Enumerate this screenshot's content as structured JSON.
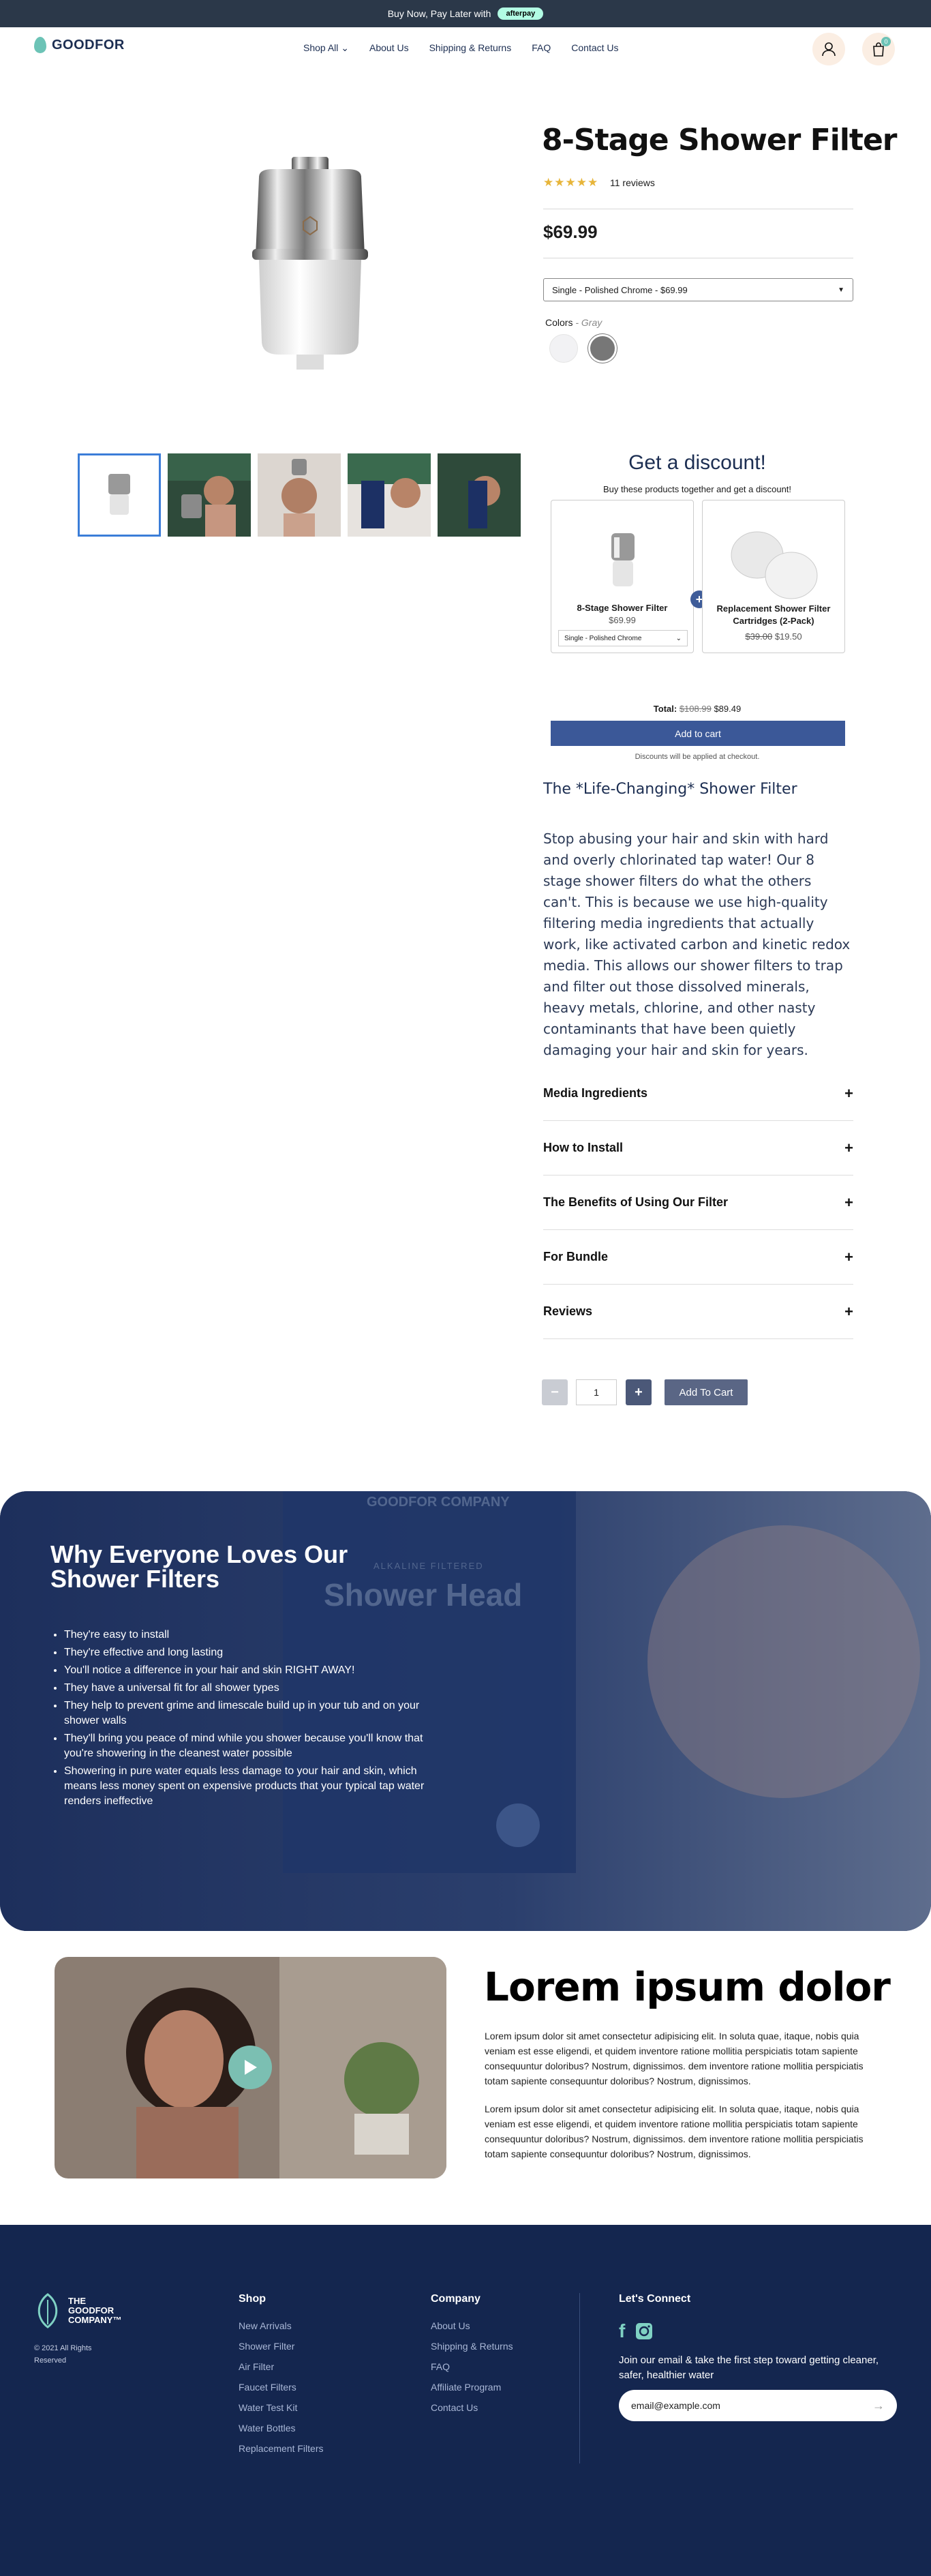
{
  "topbar": {
    "text": "Buy Now, Pay Later with",
    "badge": "afterpay"
  },
  "header": {
    "logo": "GOODFOR",
    "nav": [
      "Shop All",
      "About Us",
      "Shipping & Returns",
      "FAQ",
      "Contact Us"
    ],
    "cart_count": "0"
  },
  "product": {
    "title": "8-Stage Shower Filter",
    "stars": "★★★★★",
    "reviews": "11 reviews",
    "price": "$69.99",
    "variant": "Single - Polished Chrome - $69.99",
    "colors_label": "Colors",
    "colors_value": "- Gray",
    "swatches": [
      "#f2f2f4",
      "#7a7a7a"
    ]
  },
  "discount": {
    "title": "Get a discount!",
    "subtitle": "Buy these products together and get a discount!",
    "item1": {
      "name": "8-Stage Shower Filter",
      "price": "$69.99",
      "option": "Single - Polished Chrome"
    },
    "item2": {
      "name": "Replacement Shower Filter Cartridges (2-Pack)",
      "old_price": "$39.00",
      "price": "$19.50"
    },
    "total_label": "Total:",
    "total_old": "$108.99",
    "total_new": "$89.49",
    "button": "Add to cart",
    "note": "Discounts will be applied at checkout."
  },
  "description": {
    "heading": "The *Life-Changing* Shower Filter",
    "body": "Stop abusing your hair and skin with hard and overly chlorinated tap water! Our 8 stage shower filters do what the others can't. This is because we use high-quality filtering media ingredients that actually work, like activated carbon and kinetic redox media. This allows our shower filters to trap and filter out those dissolved minerals, heavy metals, chlorine, and other nasty contaminants that have been quietly damaging your hair and skin for years."
  },
  "accordion": [
    "Media Ingredients",
    "How to Install",
    "The Benefits of Using Our Filter",
    "For Bundle",
    "Reviews"
  ],
  "quantity": {
    "minus": "−",
    "value": "1",
    "plus": "+",
    "button": "Add To Cart"
  },
  "why": {
    "title": "Why Everyone Loves Our Shower Filters",
    "bg_text": "Shower Head",
    "bg_brand": "GOODFOR COMPANY",
    "bg_sub": "ALKALINE FILTERED",
    "items": [
      "They're easy to install",
      "They're effective and long lasting",
      "You'll notice a difference in your hair and skin RIGHT AWAY!",
      "They have a universal fit for all shower types",
      "They help to prevent grime and limescale build up in your tub and on your shower walls",
      "They'll bring you peace of mind while you shower because you'll know that you're showering in the cleanest water possible",
      "Showering in pure water equals less damage to your hair and skin, which means less money spent on expensive products that your typical tap water renders ineffective"
    ]
  },
  "lorem": {
    "heading": "Lorem ipsum dolor",
    "p1": "Lorem ipsum dolor sit amet consectetur adipisicing elit. In soluta quae, itaque, nobis quia veniam est esse eligendi, et quidem inventore ratione mollitia perspiciatis totam sapiente consequuntur doloribus? Nostrum, dignissimos. dem inventore ratione mollitia perspiciatis totam sapiente consequuntur doloribus? Nostrum, dignissimos.",
    "p2": "Lorem ipsum dolor sit amet consectetur adipisicing elit. In soluta quae, itaque, nobis quia veniam est esse eligendi, et quidem inventore ratione mollitia perspiciatis totam sapiente consequuntur doloribus? Nostrum, dignissimos. dem inventore ratione mollitia perspiciatis totam sapiente consequuntur doloribus? Nostrum, dignissimos."
  },
  "footer": {
    "logo_line1": "THE",
    "logo_line2": "GOODFOR",
    "logo_line3": "COMPANY™",
    "copyright": "© 2021 All Rights Reserved",
    "shop_title": "Shop",
    "shop": [
      "New Arrivals",
      "Shower Filter",
      "Air Filter",
      "Faucet Filters",
      "Water Test Kit",
      "Water Bottles",
      "Replacement Filters"
    ],
    "company_title": "Company",
    "company": [
      "About Us",
      "Shipping & Returns",
      "FAQ",
      "Affiliate Program",
      "Contact Us"
    ],
    "connect_title": "Let's Connect",
    "connect_text": "Join our email & take the first step toward getting cleaner, safer, healthier water",
    "email_placeholder": "email@example.com"
  }
}
